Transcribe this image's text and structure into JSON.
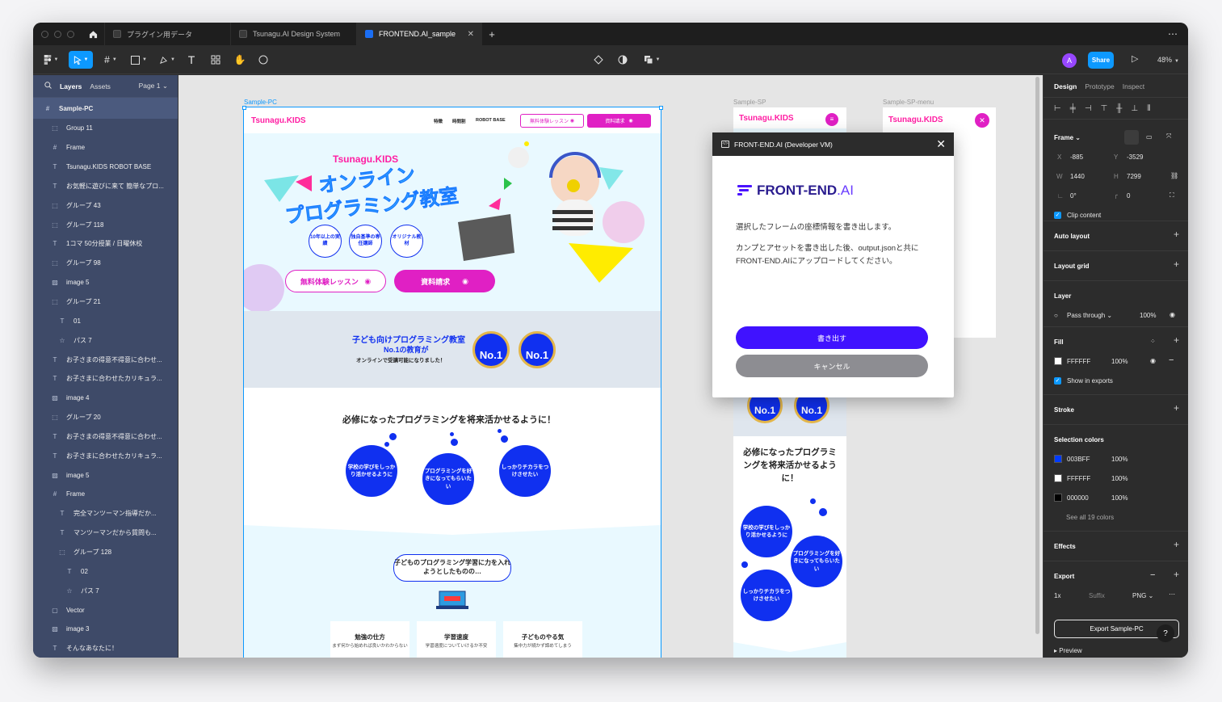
{
  "titlebar": {
    "tabs": [
      {
        "label": "プラグイン用データ"
      },
      {
        "label": "Tsunagu.AI Design System"
      },
      {
        "label": "FRONTEND.AI_sample"
      }
    ],
    "new_tab": "+",
    "more": "⋯"
  },
  "toolbar": {
    "avatar_initial": "A",
    "share_label": "Share",
    "zoom": "48%"
  },
  "layers_panel": {
    "tab_layers": "Layers",
    "tab_assets": "Assets",
    "page": "Page 1",
    "items": [
      {
        "label": "Sample-PC",
        "icon": "frame-icon"
      },
      {
        "label": "Group 11",
        "icon": "group-icon"
      },
      {
        "label": "Frame",
        "icon": "frame-icon"
      },
      {
        "label": "Tsunagu.KIDS ROBOT BASE",
        "icon": "text-icon"
      },
      {
        "label": "お気軽に遊びに来て 簡単なプロ...",
        "icon": "text-icon"
      },
      {
        "label": "グループ 43",
        "icon": "group-icon"
      },
      {
        "label": "グループ 118",
        "icon": "group-icon"
      },
      {
        "label": "1コマ 50分授業 / 日曜休校",
        "icon": "text-icon"
      },
      {
        "label": "グループ 98",
        "icon": "group-icon"
      },
      {
        "label": "image 5",
        "icon": "image-icon"
      },
      {
        "label": "グループ 21",
        "icon": "group-icon"
      },
      {
        "label": "01",
        "icon": "text-icon"
      },
      {
        "label": "パス 7",
        "icon": "star-icon"
      },
      {
        "label": "お子さまの得意不得意に合わせ...",
        "icon": "text-icon"
      },
      {
        "label": "お子さまに合わせたカリキュラ...",
        "icon": "text-icon"
      },
      {
        "label": "image 4",
        "icon": "image-icon"
      },
      {
        "label": "グループ 20",
        "icon": "group-icon"
      },
      {
        "label": "お子さまの得意不得意に合わせ...",
        "icon": "text-icon"
      },
      {
        "label": "お子さまに合わせたカリキュラ...",
        "icon": "text-icon"
      },
      {
        "label": "image 5",
        "icon": "image-icon"
      },
      {
        "label": "Frame",
        "icon": "frame-icon"
      },
      {
        "label": "完全マンツーマン指導だか...",
        "icon": "text-icon"
      },
      {
        "label": "マンツーマンだから質問も...",
        "icon": "text-icon"
      },
      {
        "label": "グループ 128",
        "icon": "group-icon"
      },
      {
        "label": "02",
        "icon": "text-icon"
      },
      {
        "label": "パス 7",
        "icon": "star-icon"
      },
      {
        "label": "Vector",
        "icon": "vector-icon"
      },
      {
        "label": "image 3",
        "icon": "image-icon"
      },
      {
        "label": "そんなあなたに！",
        "icon": "text-icon"
      }
    ]
  },
  "canvas": {
    "frame_pc_label": "Sample-PC",
    "frame_sp_label": "Sample-SP",
    "frame_spm_label": "Sample-SP-menu",
    "site": {
      "logo": "Tsunagu.KIDS",
      "nav": [
        "特徴",
        "時間割",
        "ROBOT BASE"
      ],
      "nav_trial": "無料体験レッスン",
      "nav_request": "資料請求",
      "hero_sub": "Tsunagu.KIDS",
      "hero_title_1": "オンライン",
      "hero_title_2": "プログラミング教室",
      "badges": [
        "10年以上の実績",
        "独自基準の専任講師",
        "オリジナル教材"
      ],
      "btn_trial": "無料体験レッスン",
      "btn_request": "資料請求",
      "band_line1": "子ども向けプログラミング教室",
      "band_line2": "No.1の教育が",
      "band_line3": "オンラインで受講可能になりました！",
      "medal": "No.1",
      "section_title": "必修になったプログラミングを将来活かせるように！",
      "bubbles": [
        "学校の学びをしっかり活かせるように",
        "プログラミングを好きになってもらいたい",
        "しっかりチカラをつけさせたい"
      ],
      "speech": "子どものプログラミング学習に力を入れようとしたものの…",
      "cards": [
        {
          "title": "勉強の仕方",
          "desc": "まず何から始めれば良いかわからない"
        },
        {
          "title": "学習速度",
          "desc": "学習速度についていけるか不安"
        },
        {
          "title": "子どものやる気",
          "desc": "集中力が続かず諦めてしまう"
        }
      ]
    },
    "sp": {
      "logo": "Tsunagu.KIDS",
      "section_title": "必修になったプログラミングを将来活かせるように！",
      "bubbles": [
        "学校の学びをしっかり活かせるように",
        "プログラミングを好きになってもらいたい",
        "しっかりチカラをつけさせたい"
      ]
    },
    "spm": {
      "logo": "Tsunagu.KIDS"
    }
  },
  "modal": {
    "title": "FRONT-END.AI (Developer VM)",
    "brand_main": "FRONT-END",
    "brand_ai": ".AI",
    "line1": "選択したフレームの座標情報を書き出します。",
    "line2": "カンプとアセットを書き出した後、output.jsonと共にFRONT-END.AIにアップロードしてください。",
    "primary": "書き出す",
    "cancel": "キャンセル"
  },
  "design_panel": {
    "tabs": [
      "Design",
      "Prototype",
      "Inspect"
    ],
    "frame_title": "Frame",
    "x_label": "X",
    "x": "-885",
    "y_label": "Y",
    "y": "-3529",
    "w_label": "W",
    "w": "1440",
    "h_label": "H",
    "h": "7299",
    "rotation": "0°",
    "radius": "0",
    "clip": "Clip content",
    "auto_layout": "Auto layout",
    "layout_grid": "Layout grid",
    "layer_title": "Layer",
    "blend": "Pass through",
    "opacity": "100%",
    "fill_title": "Fill",
    "fill_hex": "FFFFFF",
    "fill_opacity": "100%",
    "show_exports": "Show in exports",
    "stroke": "Stroke",
    "selection_colors": "Selection colors",
    "colors": [
      {
        "hex": "003BFF",
        "opacity": "100%",
        "swatch": "#003BFF"
      },
      {
        "hex": "FFFFFF",
        "opacity": "100%",
        "swatch": "#FFFFFF"
      },
      {
        "hex": "000000",
        "opacity": "100%",
        "swatch": "#000000"
      }
    ],
    "see_all": "See all 19 colors",
    "effects": "Effects",
    "export": "Export",
    "scale": "1x",
    "suffix_placeholder": "Suffix",
    "format": "PNG",
    "export_button": "Export Sample-PC",
    "preview": "Preview",
    "help": "?"
  }
}
